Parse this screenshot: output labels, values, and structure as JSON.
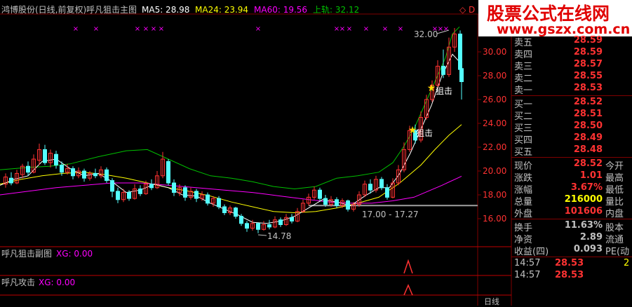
{
  "header": {
    "stock": "鸿博股份(日线,前复权)",
    "indicator": "呼凡狙击主图",
    "ma5": "MA5: 28.98",
    "ma24": "MA24: 23.94",
    "ma60": "MA60: 19.56",
    "upper": "上轨: 32.12",
    "corner": "◇ D"
  },
  "watermark": {
    "title": "股票公式在线网",
    "url": "www.gszx.com.cn"
  },
  "colors": {
    "up": "#ff3232",
    "down": "#54ffff",
    "ma5": "#ffffff",
    "ma24": "#ffff00",
    "ma60": "#ff00ff",
    "upper": "#00c000",
    "marker": "#ff00ff",
    "grid": "#800000"
  },
  "axis": {
    "ticks": [
      "30.00",
      "28.00",
      "26.00",
      "24.00",
      "22.00",
      "20.00",
      "18.00",
      "16.00"
    ]
  },
  "annotations": {
    "high": "32.00",
    "low": "14.78",
    "range": "17.00 - 17.27",
    "snipe1": "狙击",
    "snipe2": "狙击"
  },
  "subpanels": {
    "sub1_name": "呼凡狙击副图",
    "sub1_val": "XG: 0.00",
    "sub2_name": "呼凡攻击",
    "sub2_val": "XG: 0.00",
    "bottom_right": "日线"
  },
  "quote": {
    "asks": [
      {
        "label": "卖五",
        "price": "28.59"
      },
      {
        "label": "卖四",
        "price": "28.59"
      },
      {
        "label": "卖三",
        "price": "28.57"
      },
      {
        "label": "卖二",
        "price": "28.55"
      },
      {
        "label": "卖一",
        "price": "28.53"
      }
    ],
    "bids": [
      {
        "label": "买一",
        "price": "28.52"
      },
      {
        "label": "买二",
        "price": "28.51"
      },
      {
        "label": "买三",
        "price": "28.50"
      },
      {
        "label": "买四",
        "price": "28.49"
      },
      {
        "label": "买五",
        "price": "28.48"
      }
    ],
    "stats": [
      {
        "label": "现价",
        "value": "28.52",
        "label2": "今开",
        "color": "#ff3232"
      },
      {
        "label": "涨跌",
        "value": "1.01",
        "label2": "最高",
        "color": "#ff3232"
      },
      {
        "label": "涨幅",
        "value": "3.67%",
        "label2": "最低",
        "color": "#ff3232"
      },
      {
        "label": "总量",
        "value": "216000",
        "label2": "量比",
        "color": "#ffff00"
      },
      {
        "label": "外盘",
        "value": "101606",
        "label2": "内盘",
        "color": "#ff3232"
      }
    ],
    "stats2": [
      {
        "label": "换手",
        "value": "11.63%",
        "label2": "股本",
        "color": "#c0c0c0"
      },
      {
        "label": "净资",
        "value": "2.89",
        "label2": "流通",
        "color": "#c0c0c0"
      },
      {
        "label": "收益(四)",
        "value": "0.093",
        "label2": "PE(动",
        "color": "#c0c0c0"
      }
    ],
    "ticks": [
      {
        "time": "14:57",
        "price": "28.53",
        "vol": "2"
      },
      {
        "time": "14:57",
        "price": "28.53",
        "vol": ""
      }
    ]
  }
}
